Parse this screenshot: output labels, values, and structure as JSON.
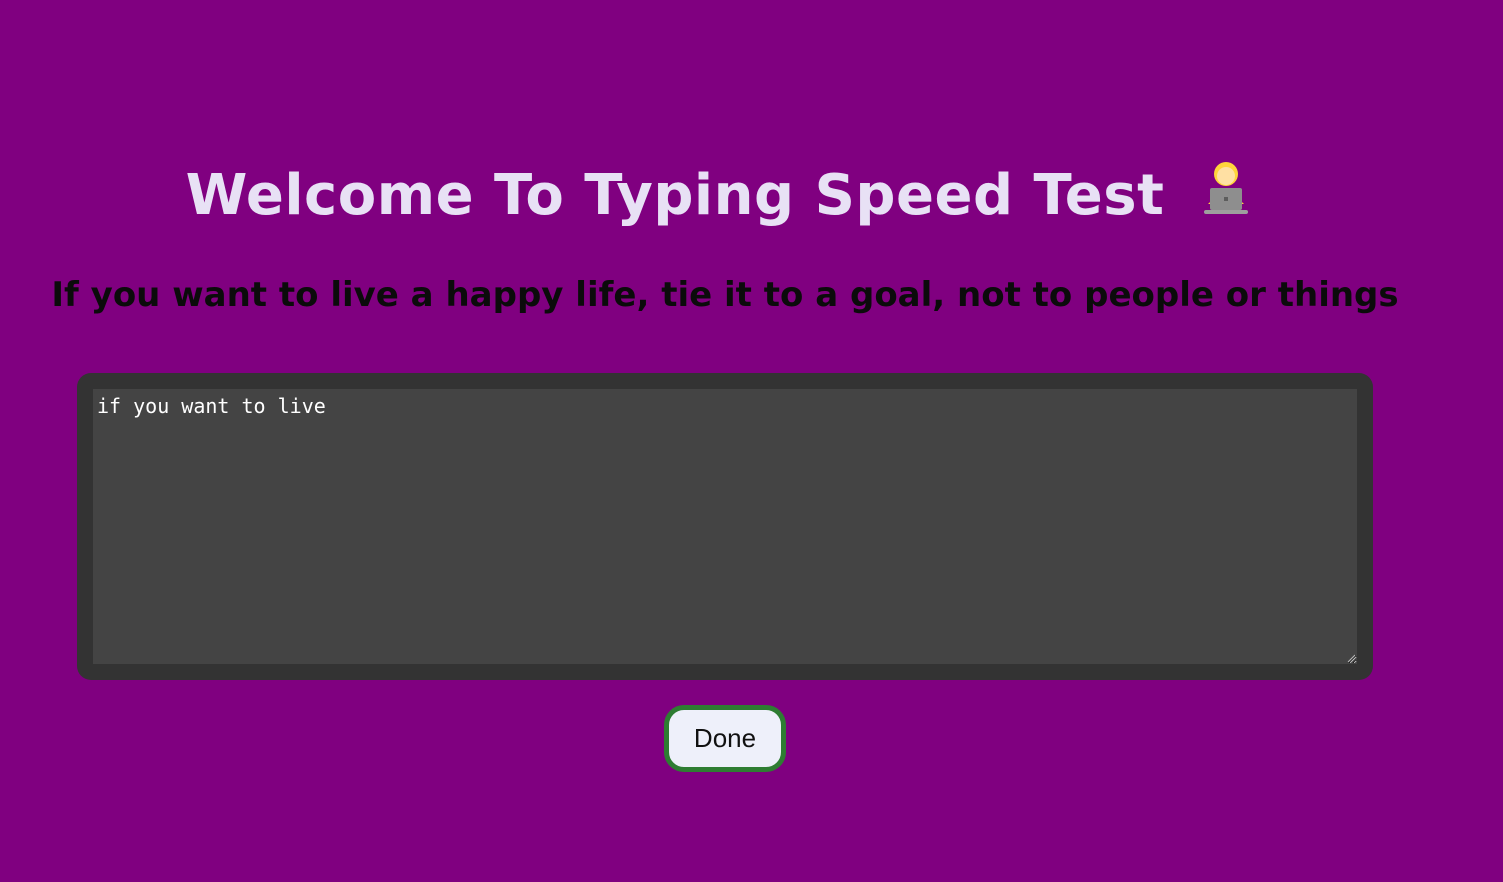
{
  "header": {
    "title": "Welcome To Typing Speed Test",
    "title_icon": "person-at-laptop-icon"
  },
  "prompt": {
    "quote": "If you want to live a happy life, tie it to a goal, not to people or things"
  },
  "typing": {
    "value": "if you want to live"
  },
  "actions": {
    "done_label": "Done"
  },
  "colors": {
    "background": "#800080",
    "title_text": "#e8e1f5",
    "editor_frame": "#333333",
    "editor_bg": "#444444",
    "button_border": "#2e7d32"
  }
}
